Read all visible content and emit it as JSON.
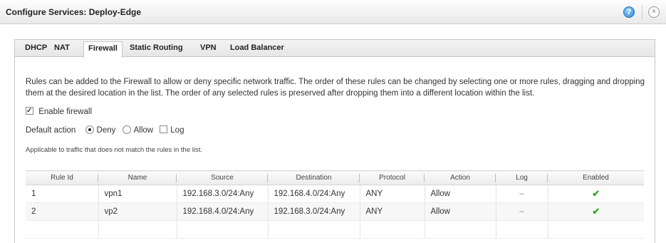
{
  "window": {
    "title": "Configure Services: Deploy-Edge",
    "help_icon": "?",
    "close_icon": "×"
  },
  "tabs": [
    {
      "label": "DHCP"
    },
    {
      "label": "NAT"
    },
    {
      "label": "Firewall",
      "active": true
    },
    {
      "label": "Static Routing"
    },
    {
      "label": "VPN"
    },
    {
      "label": "Load Balancer"
    }
  ],
  "firewall": {
    "description": "Rules can be added to the Firewall to allow or deny specific network traffic. The order of these rules can be changed by selecting one or more rules, dragging and dropping them at the desired location in the list. The order of any selected rules is preserved after dropping them into a different location within the list.",
    "enable_label": "Enable firewall",
    "enable_checked": true,
    "default_action_label": "Default action",
    "options": [
      {
        "label": "Deny",
        "selected": true
      },
      {
        "label": "Allow",
        "selected": false
      }
    ],
    "log_label": "Log",
    "log_checked": false,
    "hint": "Applicable to traffic that does not match the rules in the list."
  },
  "table": {
    "columns": [
      "Rule Id",
      "Name",
      "Source",
      "Destination",
      "Protocol",
      "Action",
      "Log",
      "Enabled"
    ],
    "rows": [
      {
        "rule_id": "1",
        "name": "vpn1",
        "source": "192.168.3.0/24:Any",
        "destination": "192.168.4.0/24:Any",
        "protocol": "ANY",
        "action": "Allow",
        "log": "–",
        "enabled": "✔"
      },
      {
        "rule_id": "2",
        "name": "vp2",
        "source": "192.168.4.0/24:Any",
        "destination": "192.168.3.0/24:Any",
        "protocol": "ANY",
        "action": "Allow",
        "log": "–",
        "enabled": "✔"
      }
    ]
  },
  "colors": {
    "enabled_check": "#3aa22d"
  }
}
